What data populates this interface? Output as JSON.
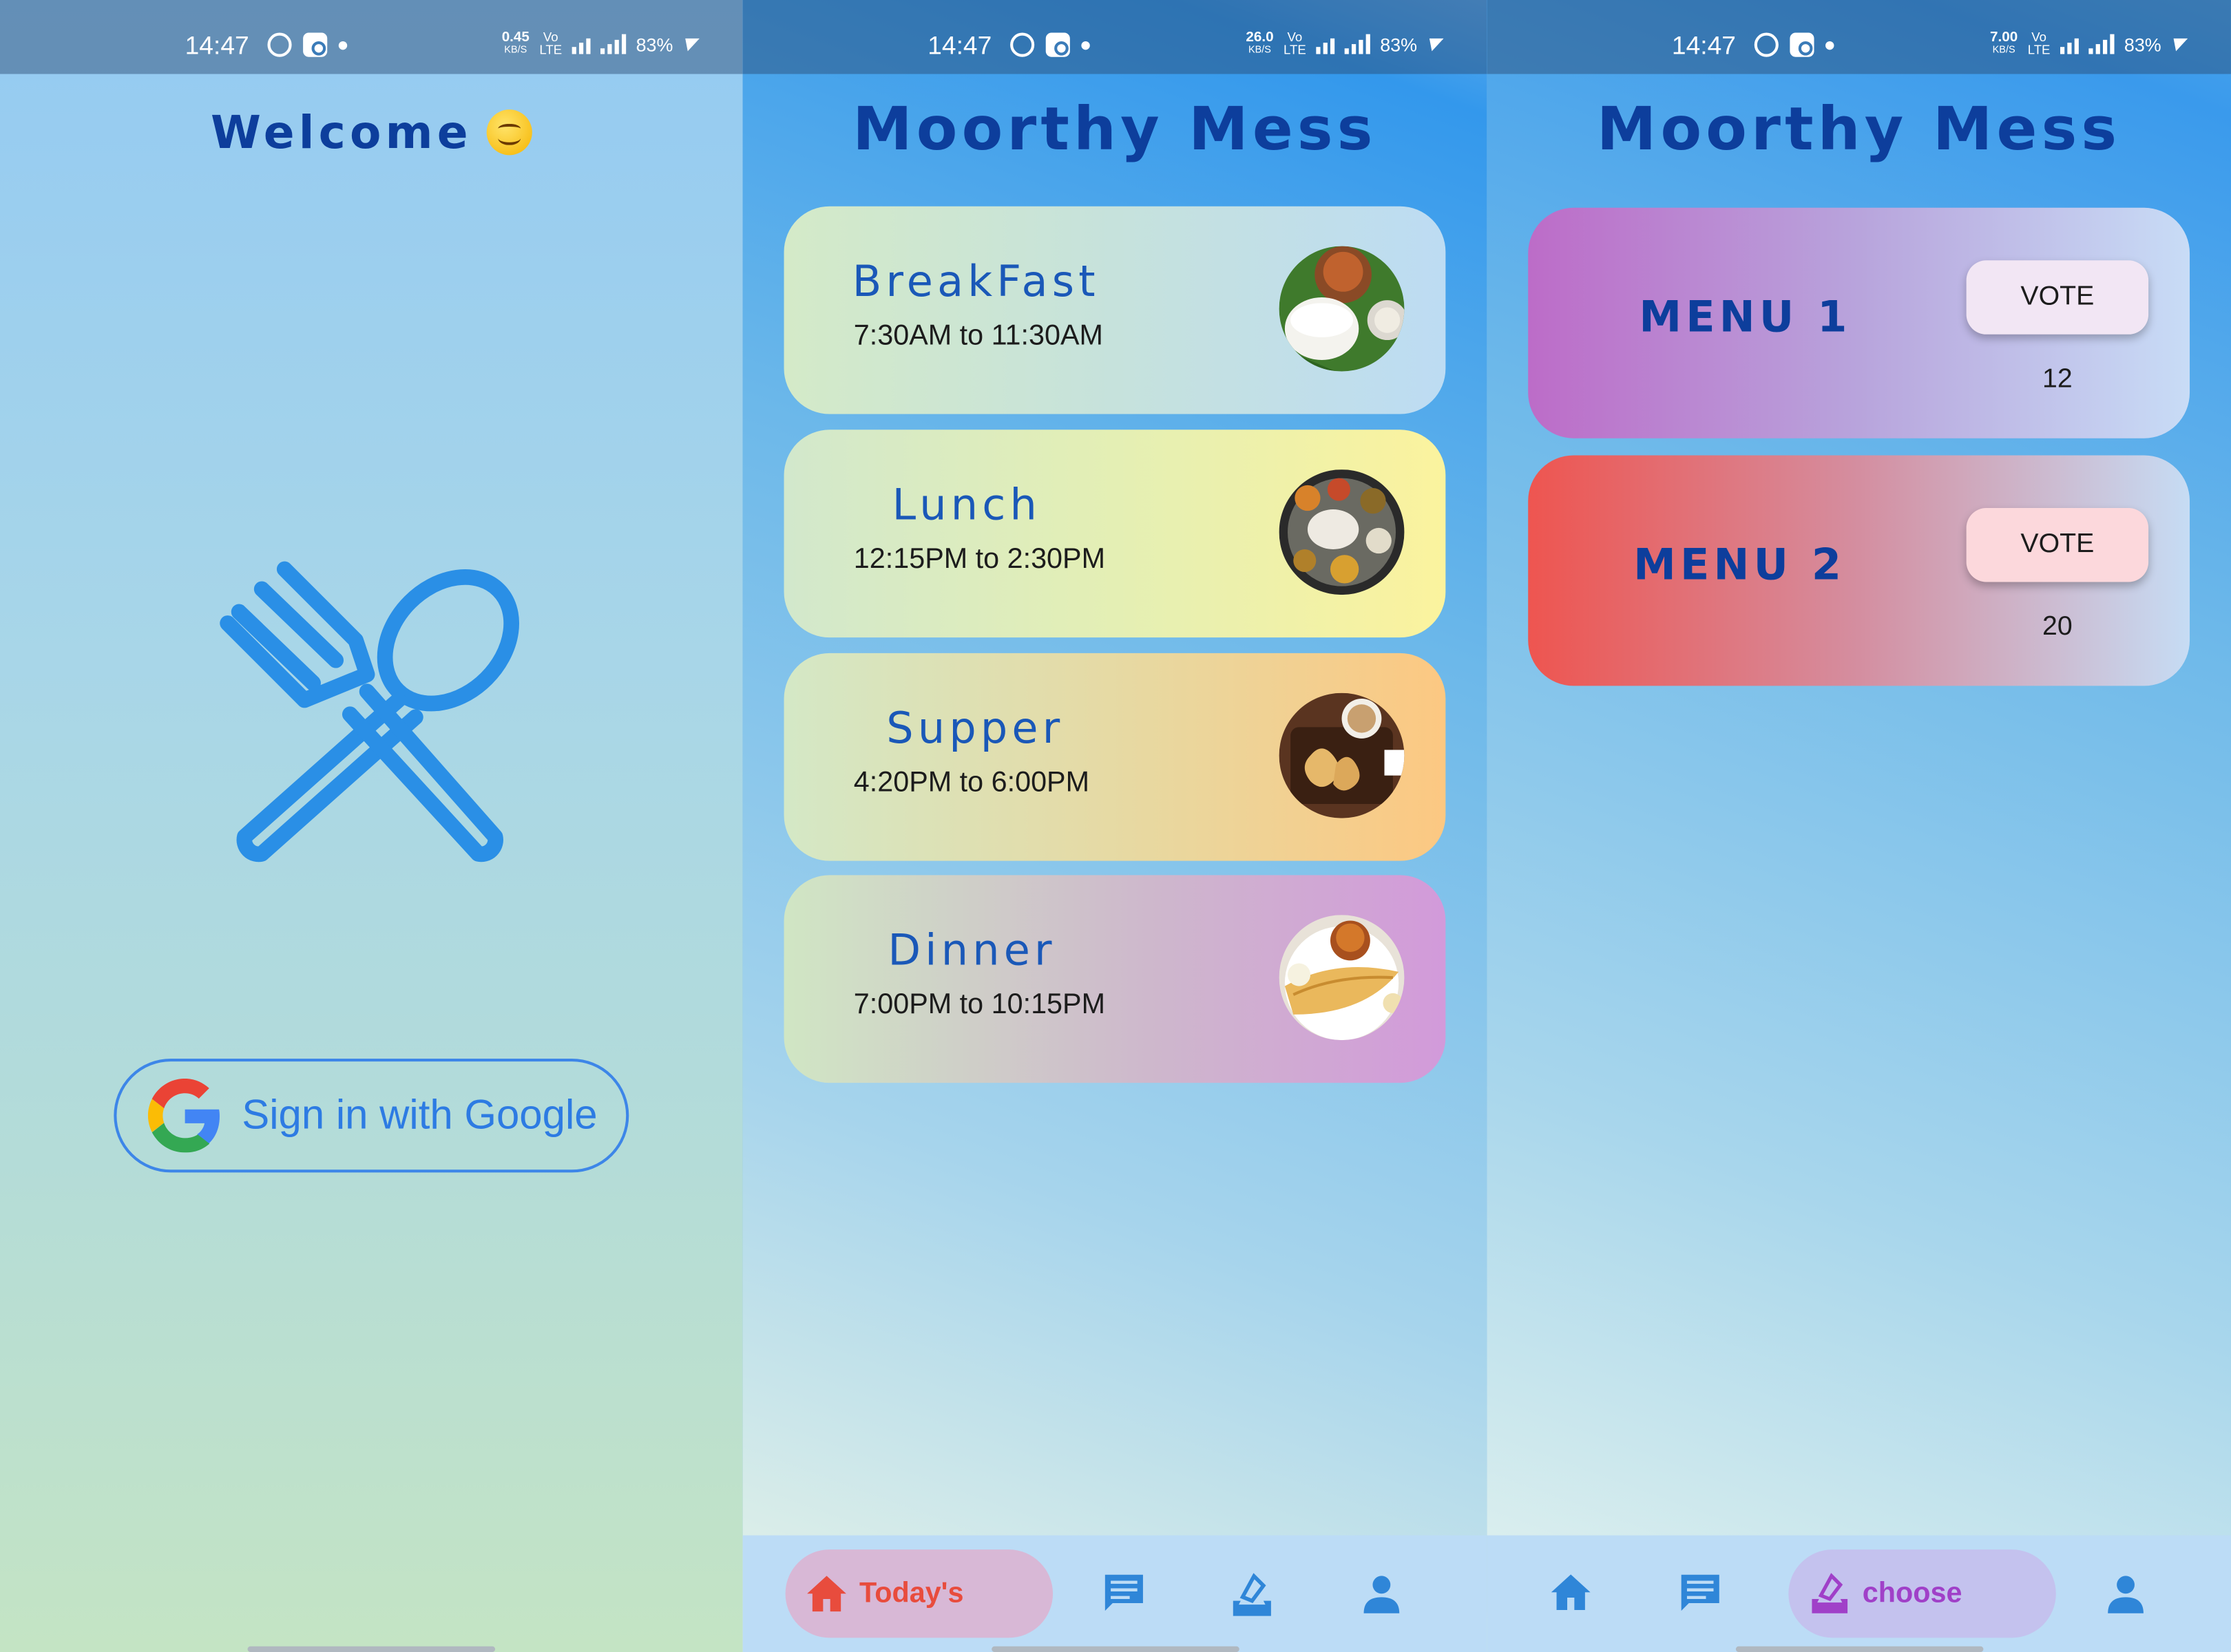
{
  "status": {
    "time": "14:47",
    "battery": "83%",
    "speed1": "0.45",
    "speed2": "26.0",
    "speed3": "7.00",
    "speed_unit": "KB/S",
    "volte_top": "Vo",
    "volte_bottom": "LTE",
    "network": "4G"
  },
  "login": {
    "welcome": "Welcome",
    "signin_label": "Sign in with Google",
    "icons": [
      "fork-spoon-icon",
      "google-logo-icon",
      "smile-emoji-icon"
    ]
  },
  "app": {
    "title": "Moorthy Mess"
  },
  "meals": [
    {
      "name": "BreakFast",
      "time": "7:30AM to 11:30AM",
      "image": "idli-sambar-photo"
    },
    {
      "name": "Lunch",
      "time": "12:15PM to 2:30PM",
      "image": "thali-photo"
    },
    {
      "name": "Supper",
      "time": "4:20PM to 6:00PM",
      "image": "tea-biscuits-photo"
    },
    {
      "name": "Dinner",
      "time": "7:00PM to 10:15PM",
      "image": "dosa-photo"
    }
  ],
  "menus": [
    {
      "name": "MENU 1",
      "vote_label": "VOTE",
      "votes": "12"
    },
    {
      "name": "MENU 2",
      "vote_label": "VOTE",
      "votes": "20"
    }
  ],
  "nav": {
    "today_label": "Today's",
    "choose_label": "choose",
    "items": [
      "home-icon",
      "chat-icon",
      "vote-icon",
      "person-icon"
    ],
    "colors": {
      "today_active": "#e84c3d",
      "choose_active": "#a040c8",
      "inactive": "#2f86d8"
    }
  }
}
